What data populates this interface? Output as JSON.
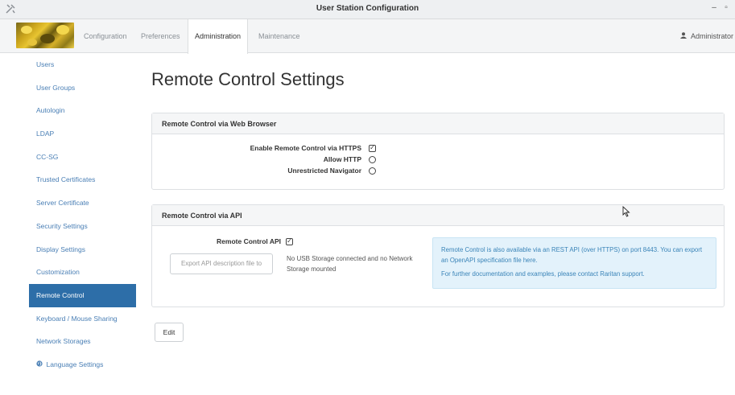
{
  "window": {
    "title": "User Station Configuration",
    "app_icon": "tools-icon",
    "minimize": "–",
    "restore": "▫"
  },
  "nav": {
    "tabs": [
      {
        "label": "Configuration"
      },
      {
        "label": "Preferences"
      },
      {
        "label": "Administration"
      },
      {
        "label": "Maintenance"
      }
    ],
    "active_tab": "Administration",
    "user": "Administrator"
  },
  "sidebar": {
    "items": [
      {
        "label": "Users"
      },
      {
        "label": "User Groups"
      },
      {
        "label": "Autologin"
      },
      {
        "label": "LDAP"
      },
      {
        "label": "CC-SG"
      },
      {
        "label": "Trusted Certificates"
      },
      {
        "label": "Server Certificate"
      },
      {
        "label": "Security Settings"
      },
      {
        "label": "Display Settings"
      },
      {
        "label": "Customization"
      },
      {
        "label": "Remote Control"
      },
      {
        "label": "Keyboard / Mouse Sharing"
      },
      {
        "label": "Network Storages"
      },
      {
        "label": "Language Settings"
      }
    ],
    "active_item": "Remote Control"
  },
  "page": {
    "title": "Remote Control Settings"
  },
  "web_panel": {
    "heading": "Remote Control via Web Browser",
    "options": [
      {
        "label": "Enable Remote Control via HTTPS",
        "checked": true
      },
      {
        "label": "Allow HTTP",
        "checked": false
      },
      {
        "label": "Unrestricted Navigator",
        "checked": false
      }
    ]
  },
  "api_panel": {
    "heading": "Remote Control via API",
    "api_label": "Remote Control API",
    "api_checked": true,
    "export_button": "Export API description file to",
    "storage_note": "No USB Storage connected and no Network Storage mounted",
    "info_line1": "Remote Control is also available via an REST API (over HTTPS) on port 8443. You can export an OpenAPI specification file here.",
    "info_line2": "For further documentation and examples, please contact Raritan support."
  },
  "actions": {
    "edit": "Edit"
  },
  "colors": {
    "link": "#4a7fb5",
    "active_sidebar": "#2d6ea8",
    "info_bg": "#e3f2fb",
    "info_text": "#3a84b8"
  }
}
